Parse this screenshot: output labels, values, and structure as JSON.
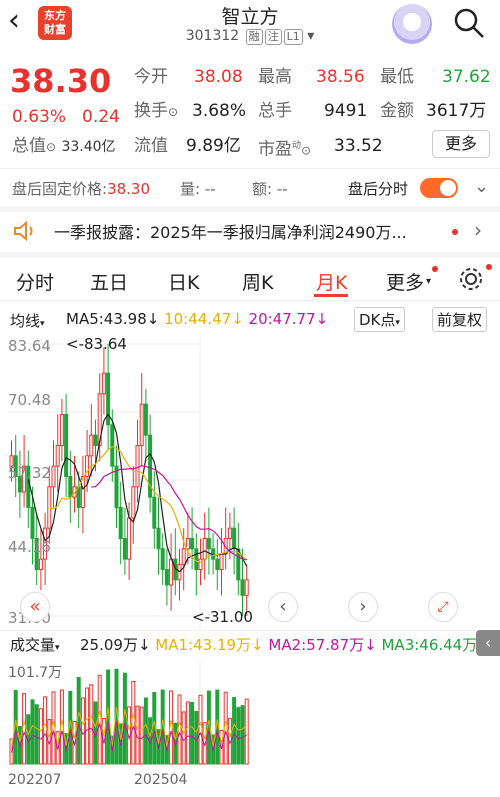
{
  "header": {
    "title": "智立方",
    "code": "301312",
    "tags": [
      "融",
      "注",
      "L1"
    ],
    "logo_line1": "东方",
    "logo_line2": "财富",
    "back_icon": "chevron-left-icon",
    "search_icon": "search-icon"
  },
  "quote": {
    "price": "38.30",
    "change_pct": "0.63%",
    "change": "0.24",
    "open_label": "今开",
    "open": "38.08",
    "high_label": "最高",
    "high": "38.56",
    "low_label": "最低",
    "low": "37.62",
    "turnover_label": "换手",
    "turnover": "3.68%",
    "volume_label": "总手",
    "volume": "9491",
    "amount_label": "金额",
    "amount": "3617万",
    "mktcap_label": "总值",
    "mktcap": "33.40亿",
    "float_label": "流值",
    "float": "9.89亿",
    "pe_label": "市盈",
    "pe_sup": "动",
    "pe": "33.52",
    "more_label": "更多"
  },
  "after_hours": {
    "fixed_label": "盘后固定价格:",
    "fixed_value": "38.30",
    "vol_label": "量:",
    "vol_value": "--",
    "amt_label": "额:",
    "amt_value": "--",
    "timeshare_label": "盘后分时"
  },
  "news": {
    "text": "一季报披露：2025年一季报归属净利润2490万..."
  },
  "tabs": [
    "分时",
    "五日",
    "日K",
    "周K",
    "月K",
    "更多"
  ],
  "active_tab": "月K",
  "indicators": {
    "ma_label": "均线",
    "ma5": "MA5:43.98",
    "ma10": "10:44.47",
    "ma20": "20:47.77",
    "dk": "DK点",
    "fq": "前复权"
  },
  "chart_data": {
    "type": "candlestick",
    "y_ticks": [
      "83.64",
      "70.48",
      "57.32",
      "44.16",
      "31.00"
    ],
    "high_label": "<-83.64",
    "low_label": "<-31.00",
    "ylim": [
      31.0,
      83.64
    ],
    "closes": [
      62,
      58,
      55,
      60,
      52,
      46,
      40,
      42,
      48,
      56,
      60,
      64,
      70,
      58,
      54,
      56,
      52,
      58,
      62,
      66,
      64,
      74,
      78,
      68,
      60,
      52,
      46,
      42,
      50,
      56,
      64,
      72,
      66,
      54,
      48,
      44,
      40,
      37,
      42,
      38,
      41,
      44,
      46,
      44,
      40,
      42,
      46,
      44,
      42,
      40,
      43,
      46,
      48,
      44,
      38,
      35,
      38
    ],
    "ma5_color": "#222",
    "ma10_color": "#e0b400",
    "ma20_color": "#c2169c",
    "up_color": "#e8322e",
    "down_color": "#22a33a",
    "x_labels": [
      "202207",
      "202504"
    ]
  },
  "volume": {
    "label": "成交量",
    "value": "25.09万",
    "ma1": "MA1:43.19万",
    "ma2": "MA2:57.87万",
    "ma3": "MA3:46.44万",
    "max_label": "101.7万"
  }
}
